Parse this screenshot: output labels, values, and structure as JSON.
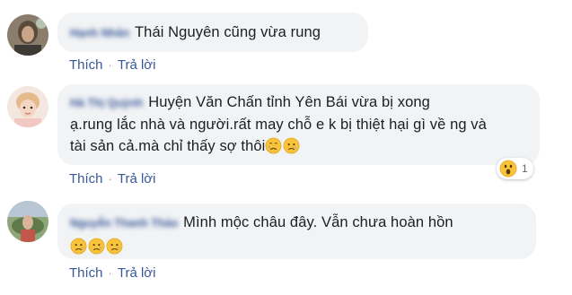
{
  "comments": [
    {
      "author": "Hạnh Nhân",
      "text": "Thái Nguyên cũng vừa rung",
      "emoji_count": 0,
      "avatar_icon": "user-avatar-icon",
      "actions": {
        "like": "Thích",
        "separator": "·",
        "reply": "Trả lời"
      }
    },
    {
      "author": "Hà Thị Quỳnh",
      "text_lines": [
        "Huyện Văn Chấn tỉnh Yên Bái vừa bị xong",
        "ạ.rung lắc nhà và người.rất may chỗ e k bị thiệt hại gì về ng và",
        "tài sản cả.mà chỉ thấy sợ thôi"
      ],
      "emojis": [
        "crying-face-icon",
        "sad-face-icon"
      ],
      "reaction": {
        "icon": "wow-reaction-icon",
        "count": "1"
      },
      "avatar_icon": "user-avatar-icon",
      "actions": {
        "like": "Thích",
        "separator": "·",
        "reply": "Trả lời"
      }
    },
    {
      "author": "Nguyễn Thanh Thảo",
      "text": "Mình mộc châu đây. Vẫn chưa hoàn hồn",
      "emojis": [
        "sad-face-icon",
        "sad-face-icon",
        "sad-face-icon"
      ],
      "avatar_icon": "user-avatar-icon",
      "actions": {
        "like": "Thích",
        "separator": "·",
        "reply": "Trả lời"
      }
    }
  ],
  "colors": {
    "bubble": "#f2f3f5",
    "author": "#385898",
    "link": "#385898",
    "text": "#1c1e21"
  }
}
